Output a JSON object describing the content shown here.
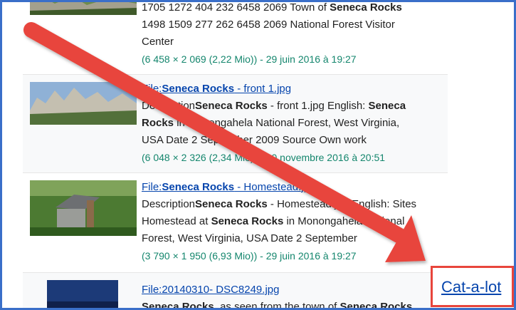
{
  "results": [
    {
      "desc_line1": "1705 1272 404 232 6458 2069 Town of ",
      "desc_line1_bold": "Seneca Rocks",
      "desc_line2": "1498 1509 277 262 6458 2069 National Forest Visitor",
      "desc_line3": "Center",
      "meta": "(6 458 × 2 069 (2,22 Mio)) - 29 juin 2016 à 19:27"
    },
    {
      "title_prefix": "File:",
      "title_bold": "Seneca Rocks",
      "title_suffix": " - front 1.jpg",
      "d1a": "Description",
      "d1b": "Seneca Rocks",
      "d1c": " - front 1.jpg English: ",
      "d1d": "Seneca",
      "d2a": "Rocks",
      "d2b": " in Monongahela National Forest, West Virginia,",
      "d3": "USA Date 2 September 2009 Source Own work",
      "meta": "(6 048 × 2 326 (2,34 Mio)) - 30 novembre 2016 à 20:51"
    },
    {
      "title_prefix": "File:",
      "title_bold": "Seneca Rocks",
      "title_suffix": " - Homestead.jpg",
      "d1a": "Description",
      "d1b": "Seneca Rocks",
      "d1c": " - Homestead.jpg English: Sites",
      "d2a": "Homestead at ",
      "d2b": "Seneca Rocks",
      "d2c": " in Monongahela National",
      "d3": "Forest, West Virginia, USA Date 2 September",
      "meta": "(3 790 × 1 950 (6,93 Mio)) - 29 juin 2016 à 19:27"
    },
    {
      "title": "File:20140310- DSC8249.jpg",
      "d1a": "Seneca Rocks",
      "d1b": ", as seen from the town of ",
      "d1c": "Seneca Rocks"
    }
  ],
  "catalot_label": "Cat-a-lot",
  "colors": {
    "arrow": "#e8453c",
    "frame": "#3a6fc9",
    "link": "#0645ad",
    "meta": "#14866d"
  }
}
